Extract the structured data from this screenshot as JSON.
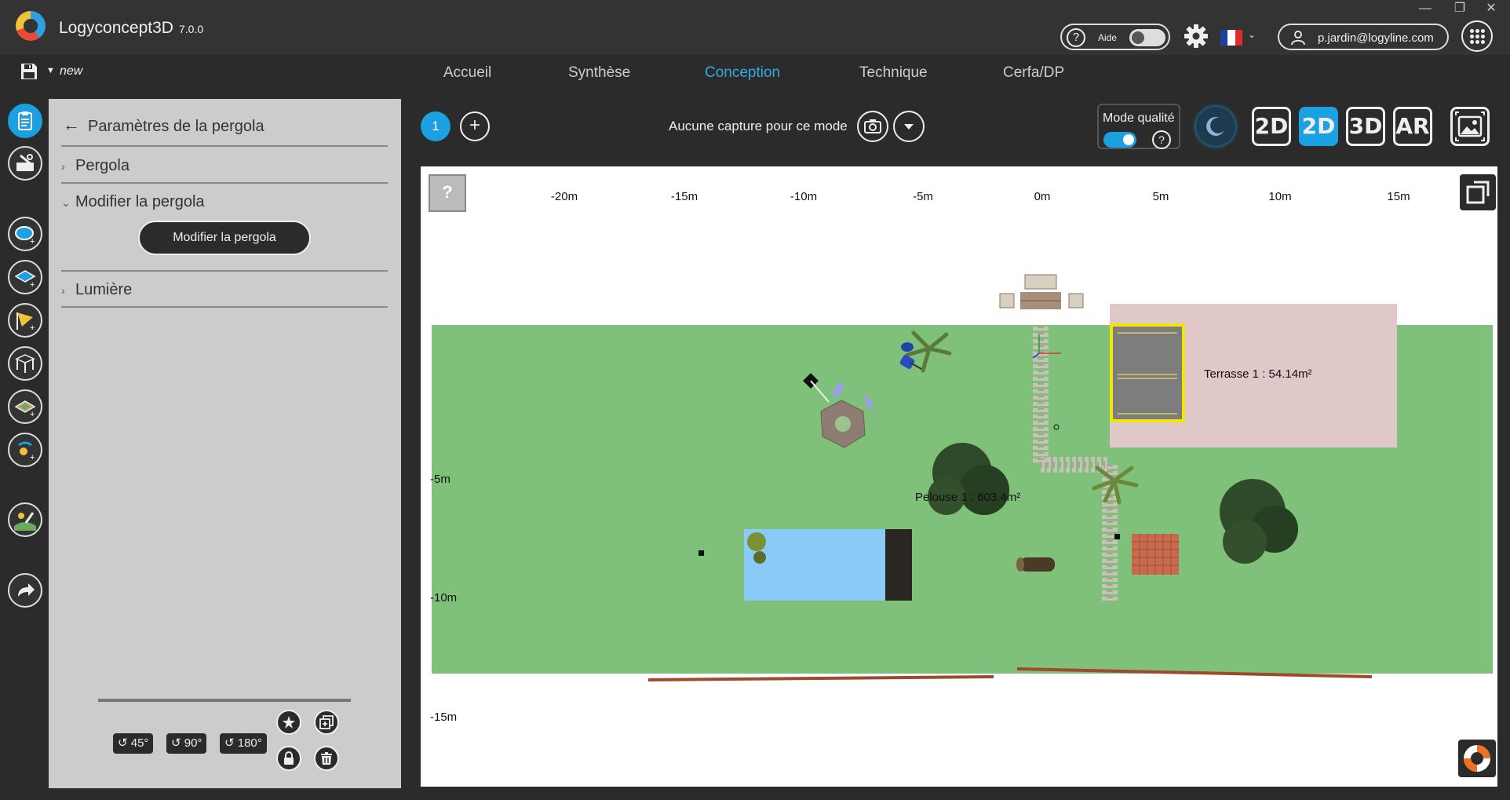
{
  "app": {
    "name": "Logyconcept3D",
    "version": "7.0.0",
    "help_label": "Aide",
    "user_email": "p.jardin@logyline.com",
    "document_name": "new",
    "window_controls": [
      "—",
      "❐",
      "✕"
    ]
  },
  "nav": {
    "tabs": [
      {
        "label": "Accueil",
        "active": false
      },
      {
        "label": "Synthèse",
        "active": false
      },
      {
        "label": "Conception",
        "active": true
      },
      {
        "label": "Technique",
        "active": false
      },
      {
        "label": "Cerfa/DP",
        "active": false
      }
    ]
  },
  "left_toolbar": {
    "icons": [
      "clipboard-icon",
      "toolbox-icon",
      "add-pool-icon",
      "add-terrace-icon",
      "add-sail-icon",
      "add-pergola-icon",
      "add-ground-icon",
      "add-light-icon",
      "sun-edit-icon",
      "share-icon"
    ]
  },
  "panel": {
    "title": "Paramètres de la pergola",
    "sections": [
      {
        "label": "Pergola",
        "expanded": false
      },
      {
        "label": "Modifier la pergola",
        "expanded": true
      },
      {
        "label": "Lumière",
        "expanded": false
      }
    ],
    "modify_button": "Modifier la pergola",
    "rotations": [
      "45°",
      "90°",
      "180°"
    ]
  },
  "view_toolbar": {
    "page_number": "1",
    "add_label": "+",
    "capture_label": "Aucune capture pour ce mode",
    "quality_label": "Mode qualité",
    "help_glyph": "?",
    "view_modes": [
      {
        "label": "2D",
        "active": false
      },
      {
        "label": "2D",
        "active": true
      },
      {
        "label": "3D",
        "active": false
      },
      {
        "label": "AR",
        "active": false
      }
    ]
  },
  "canvas": {
    "help_glyph": "?",
    "ruler_x": [
      "-20m",
      "-15m",
      "-10m",
      "-5m",
      "0m",
      "5m",
      "10m",
      "15m"
    ],
    "ruler_y": [
      "-5m",
      "-10m",
      "-15m"
    ],
    "terrace_label": "Terrasse 1 : 54.14m²",
    "lawn_label": "Pelouse 1 : 603.4m²"
  },
  "colors": {
    "accent": "#1ba1e2",
    "lawn": "#7fc07a",
    "terrace": "#e0c8c8",
    "pool": "#89caf6"
  }
}
